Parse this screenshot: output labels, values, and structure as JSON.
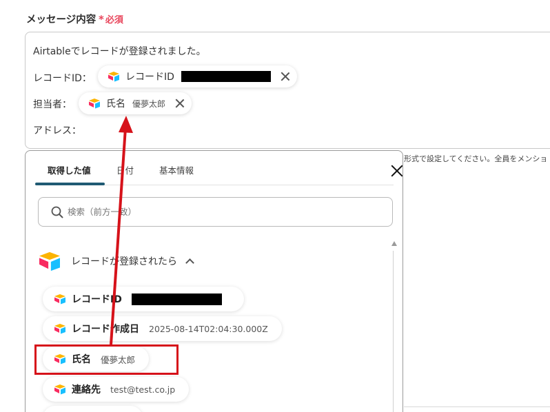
{
  "field": {
    "label": "メッセージ内容",
    "required_mark": "*",
    "required_text": "必須"
  },
  "editor": {
    "line1": "Airtableでレコードが登録されました。",
    "line2_label": "レコードID：",
    "line3_label": "担当者：",
    "line4_label": "アドレス："
  },
  "chips": {
    "record_id": {
      "name": "レコードID",
      "value_redacted": true
    },
    "person": {
      "name": "氏名",
      "value": "優夢太郎"
    }
  },
  "hint_text": "形式で設定してください。全員をメンショ",
  "popup": {
    "tabs": [
      {
        "label": "取得した値",
        "active": true
      },
      {
        "label": "日付",
        "active": false
      },
      {
        "label": "基本情報",
        "active": false
      }
    ],
    "search_placeholder": "検索（前方一致）",
    "section_title": "レコードが登録されたら",
    "items": [
      {
        "name": "レコードID",
        "value": "",
        "redacted": true
      },
      {
        "name": "レコード作成日",
        "value": "2025-08-14T02:04:30.000Z"
      },
      {
        "name": "氏名",
        "value": "優夢太郎"
      },
      {
        "name": "連絡先",
        "value": "test@test.co.jp"
      }
    ]
  },
  "colors": {
    "required": "#e8455b",
    "tab_underline": "#1f5a73",
    "annotation": "#d6121a",
    "airtable_yellow": "#fcb400",
    "airtable_blue": "#18bfff",
    "airtable_red": "#f82b60"
  },
  "icons": [
    "airtable-icon",
    "close-icon",
    "search-icon",
    "chevron-up-icon",
    "arrow-annotation"
  ]
}
